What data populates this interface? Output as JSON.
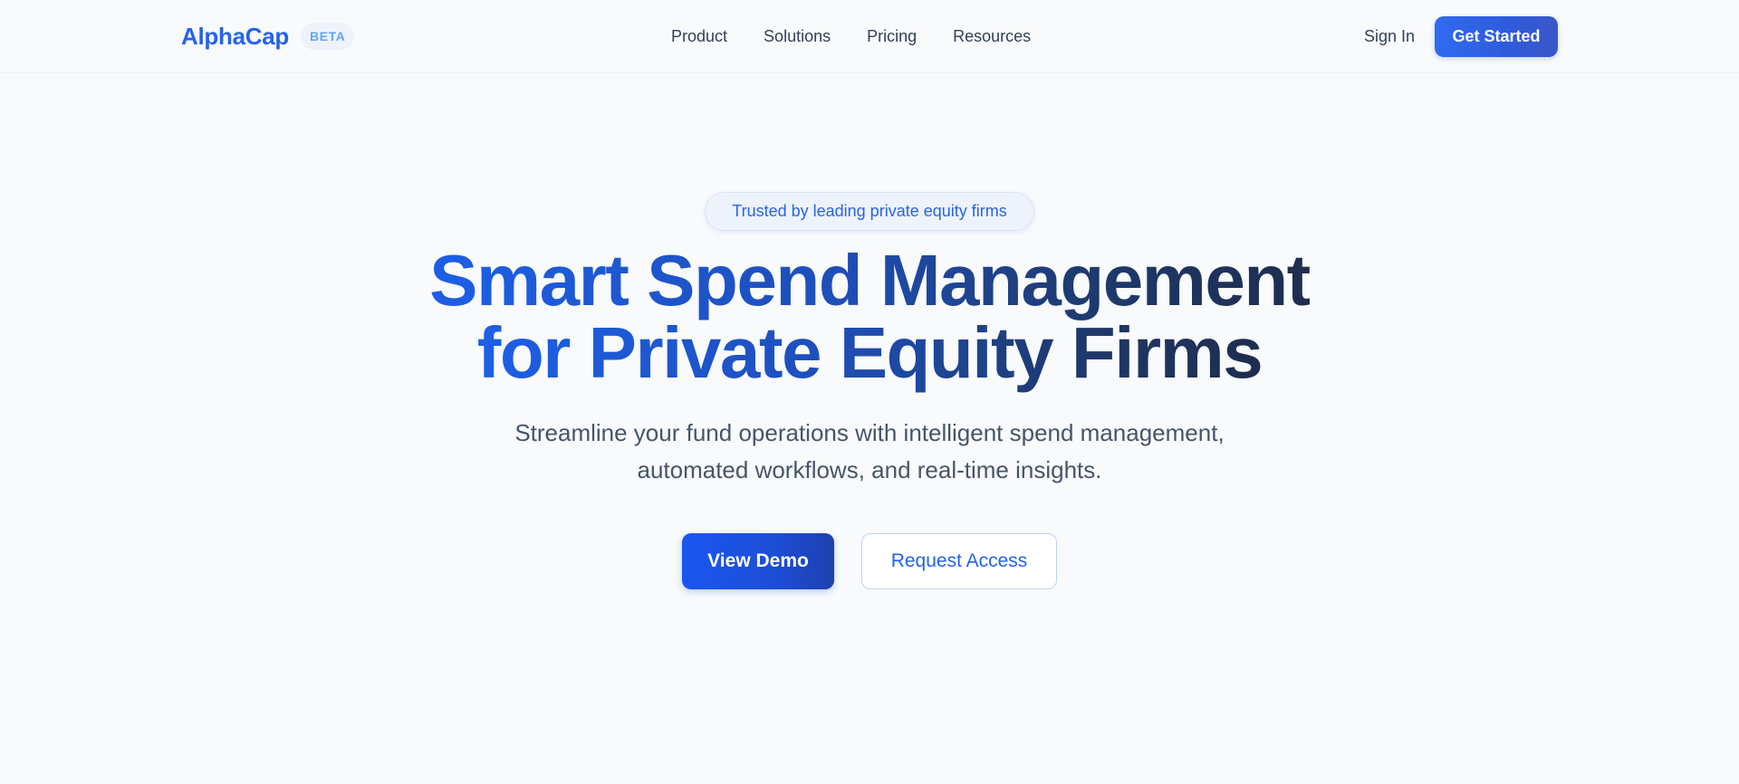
{
  "nav": {
    "logo": "AlphaCap",
    "badge": "BETA",
    "links": [
      "Product",
      "Solutions",
      "Pricing",
      "Resources"
    ],
    "sign_in": "Sign In",
    "get_started": "Get Started"
  },
  "hero": {
    "trust_badge": "Trusted by leading private equity firms",
    "headline_line1": "Smart Spend Management",
    "headline_line2": "for Private Equity Firms",
    "subtitle_line1": "Streamline your fund operations with intelligent spend management,",
    "subtitle_line2": "automated workflows, and real-time insights.",
    "primary_cta": "View Demo",
    "secondary_cta": "Request Access"
  },
  "colors": {
    "brand": "#2563eb",
    "headline_start": "#1d5fe6",
    "headline_end": "#1e2d4e",
    "background": "#f8fafc"
  }
}
